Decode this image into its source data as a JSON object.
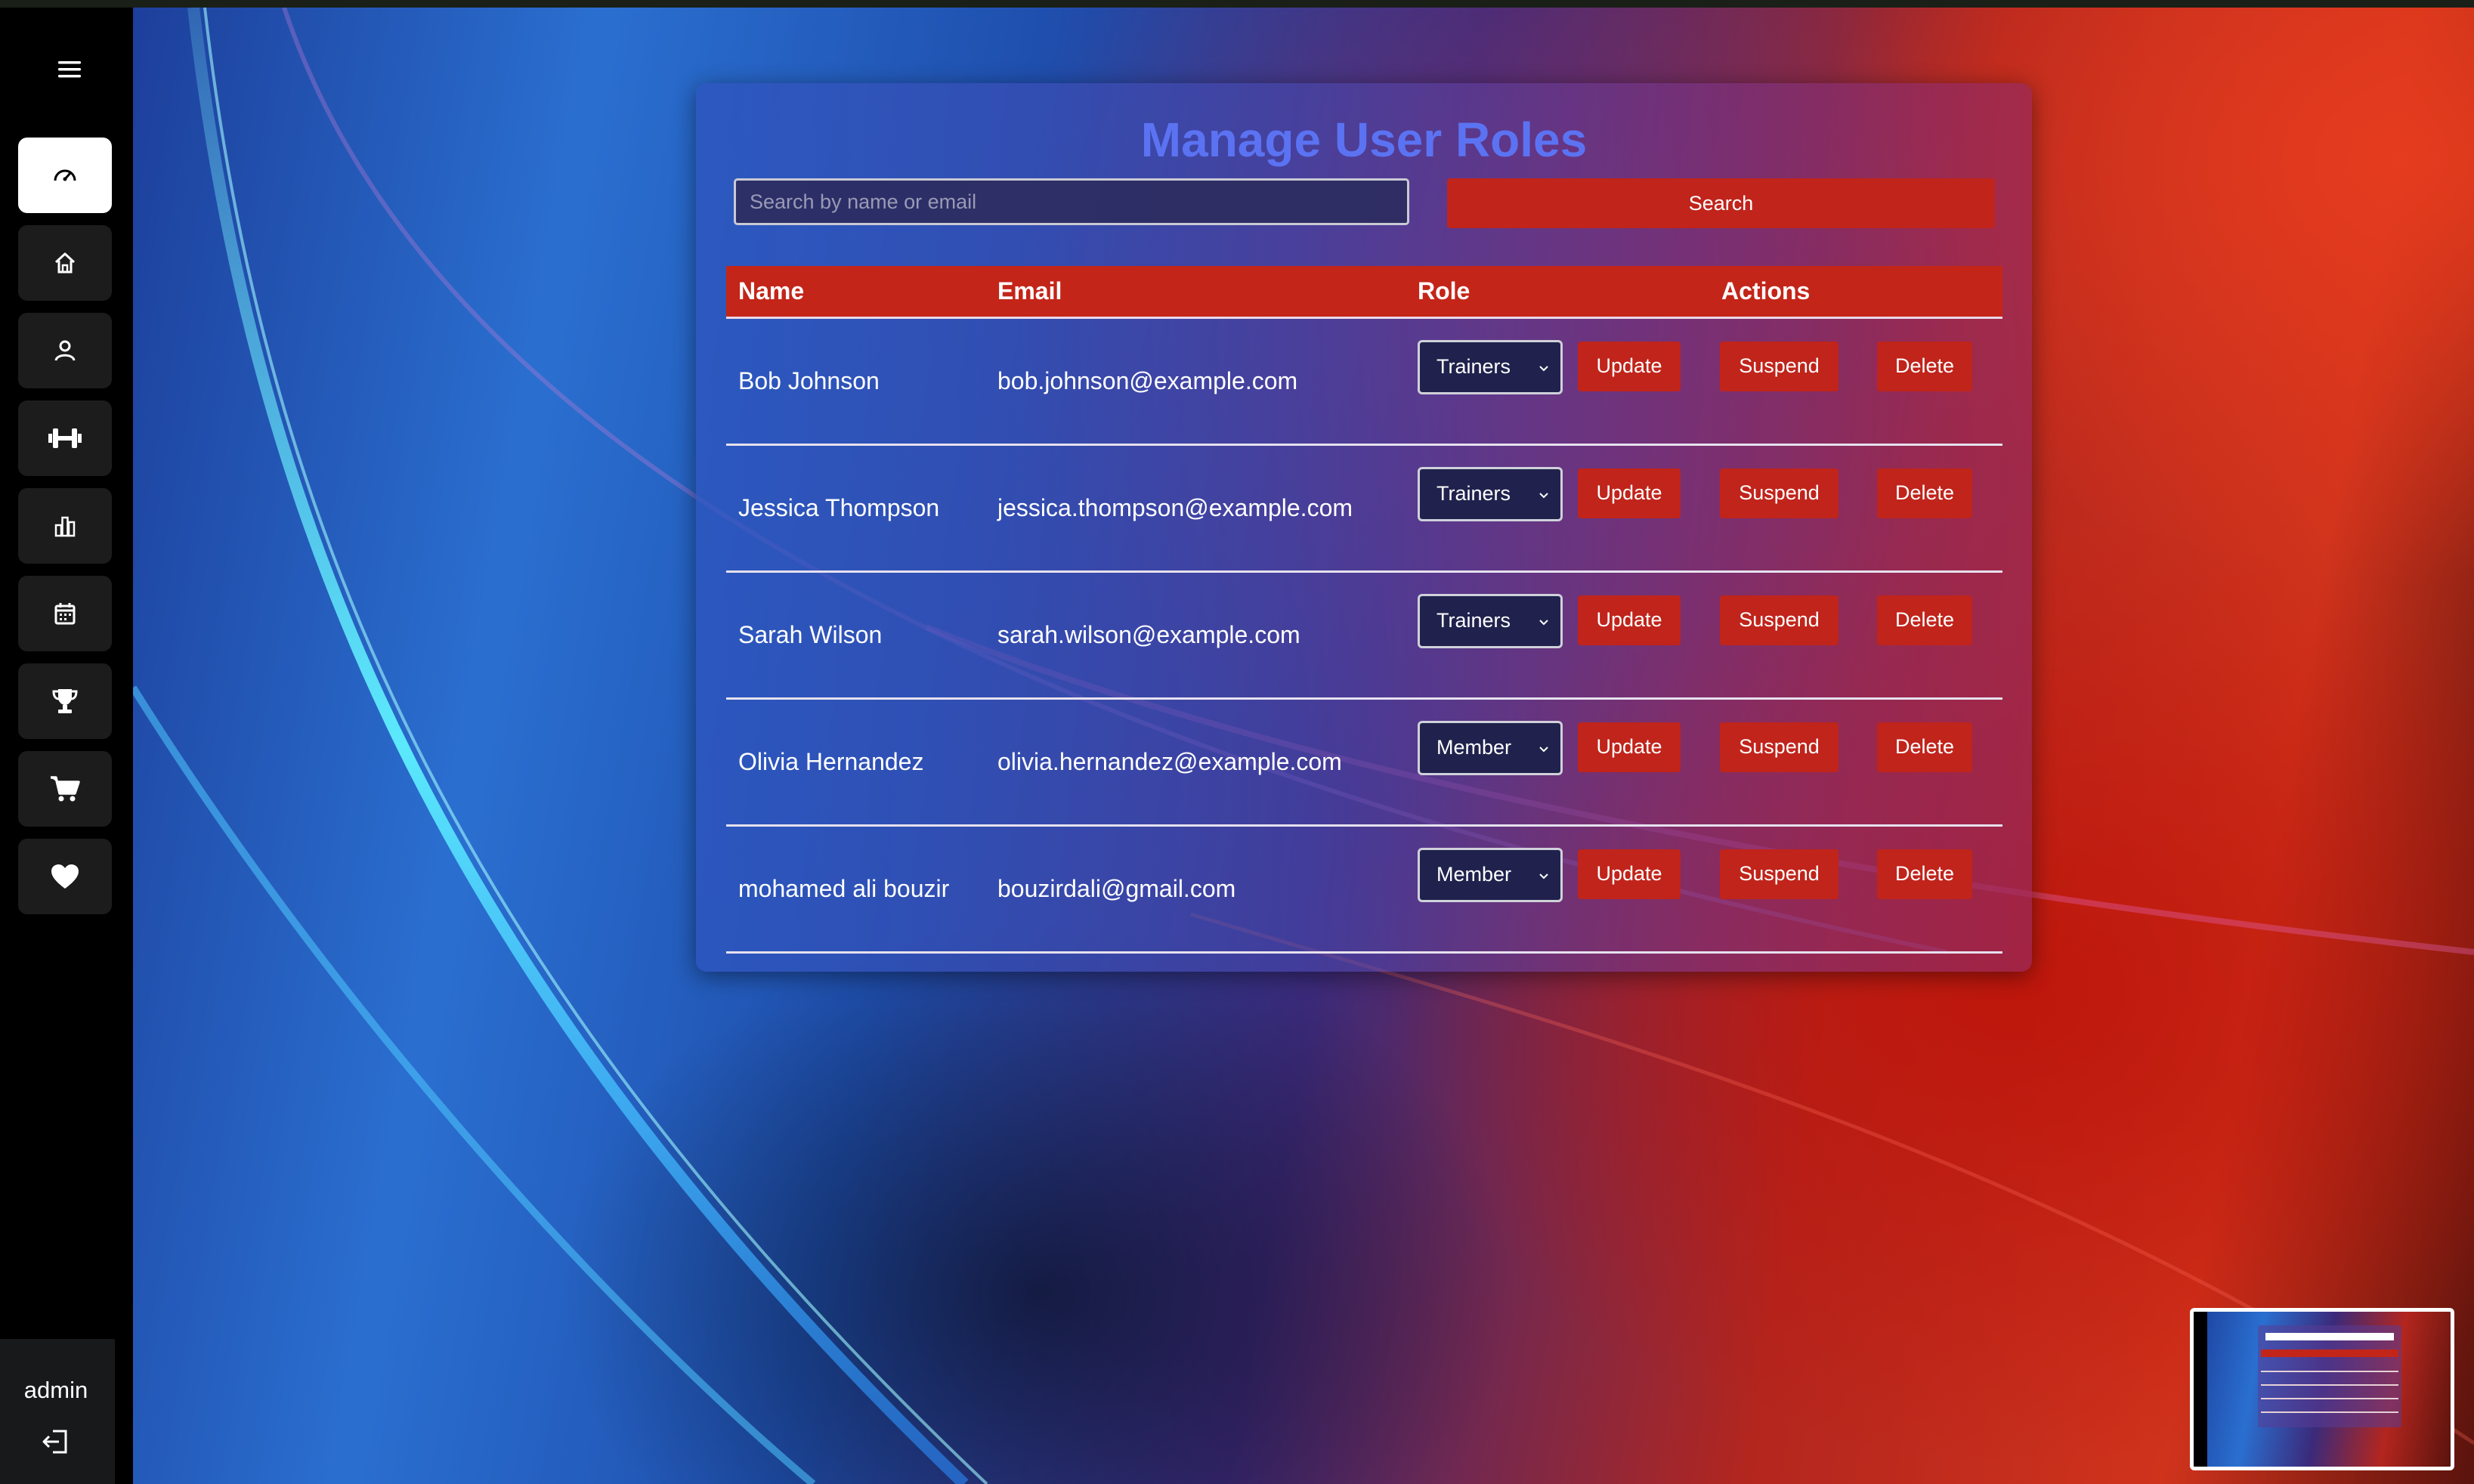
{
  "colors": {
    "accent_red": "#c0241b",
    "title_blue": "#5b73f2",
    "sidebar_bg": "#000000",
    "select_bg": "#20224d"
  },
  "sidebar": {
    "menu_icon": "hamburger-menu-icon",
    "items": [
      {
        "icon": "dashboard-gauge-icon",
        "active": true
      },
      {
        "icon": "home-icon",
        "active": false
      },
      {
        "icon": "user-icon",
        "active": false
      },
      {
        "icon": "dumbbell-icon",
        "active": false
      },
      {
        "icon": "bar-chart-icon",
        "active": false
      },
      {
        "icon": "calendar-icon",
        "active": false
      },
      {
        "icon": "trophy-icon",
        "active": false
      },
      {
        "icon": "shopping-cart-icon",
        "active": false
      },
      {
        "icon": "heart-icon",
        "active": false
      }
    ],
    "user": {
      "name": "admin",
      "logout_icon": "logout-icon"
    }
  },
  "main": {
    "title": "Manage User Roles",
    "search": {
      "placeholder": "Search by name or email",
      "value": "",
      "button_label": "Search"
    },
    "table": {
      "headers": {
        "name": "Name",
        "email": "Email",
        "role": "Role",
        "actions": "Actions"
      },
      "rows": [
        {
          "name": "Bob Johnson",
          "email": "bob.johnson@example.com",
          "role": "Trainers",
          "update": "Update",
          "suspend": "Suspend",
          "delete": "Delete"
        },
        {
          "name": "Jessica Thompson",
          "email": "jessica.thompson@example.com",
          "role": "Trainers",
          "update": "Update",
          "suspend": "Suspend",
          "delete": "Delete"
        },
        {
          "name": "Sarah Wilson",
          "email": "sarah.wilson@example.com",
          "role": "Trainers",
          "update": "Update",
          "suspend": "Suspend",
          "delete": "Delete"
        },
        {
          "name": "Olivia Hernandez",
          "email": "olivia.hernandez@example.com",
          "role": "Member",
          "update": "Update",
          "suspend": "Suspend",
          "delete": "Delete"
        },
        {
          "name": "mohamed ali bouzir",
          "email": "bouzirdali@gmail.com",
          "role": "Member",
          "update": "Update",
          "suspend": "Suspend",
          "delete": "Delete"
        }
      ]
    }
  }
}
